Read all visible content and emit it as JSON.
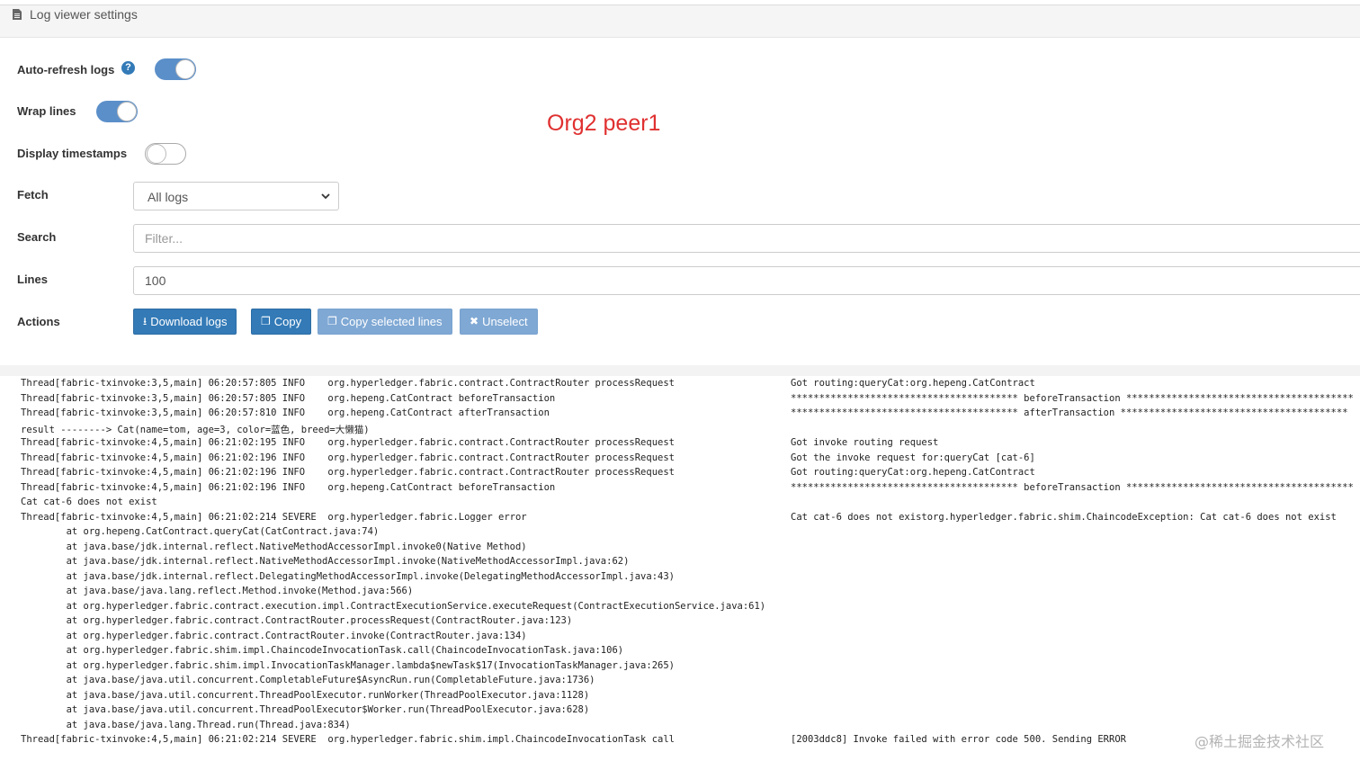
{
  "header": {
    "title": "Log viewer settings",
    "icon": "document-icon"
  },
  "settings": {
    "auto_refresh": {
      "label": "Auto-refresh logs",
      "help_glyph": "?",
      "enabled": true
    },
    "wrap_lines": {
      "label": "Wrap lines",
      "enabled": true
    },
    "display_timestamps": {
      "label": "Display timestamps",
      "enabled": false
    },
    "fetch": {
      "label": "Fetch",
      "selected": "All logs"
    },
    "search": {
      "label": "Search",
      "placeholder": "Filter..."
    },
    "lines": {
      "label": "Lines",
      "value": "100"
    },
    "actions": {
      "label": "Actions",
      "download": {
        "label": "Download logs",
        "icon": "download-icon",
        "glyph": "⭳"
      },
      "copy": {
        "label": "Copy",
        "icon": "copy-icon",
        "glyph": "❐"
      },
      "copy_selected": {
        "label": "Copy selected lines",
        "icon": "copy-icon",
        "glyph": "❐"
      },
      "unselect": {
        "label": "Unselect",
        "icon": "close-icon",
        "glyph": "✖"
      }
    }
  },
  "annotation": "Org2 peer1",
  "log_lines": [
    {
      "left": "Thread[fabric-txinvoke:3,5,main] 06:20:57:805 INFO    org.hyperledger.fabric.contract.ContractRouter processRequest",
      "right": "Got routing:queryCat:org.hepeng.CatContract"
    },
    {
      "left": "Thread[fabric-txinvoke:3,5,main] 06:20:57:805 INFO    org.hepeng.CatContract beforeTransaction",
      "right": "**************************************** beforeTransaction ****************************************"
    },
    {
      "left": "Thread[fabric-txinvoke:3,5,main] 06:20:57:810 INFO    org.hepeng.CatContract afterTransaction",
      "right": "**************************************** afterTransaction ****************************************"
    },
    {
      "left": "result --------> Cat(name=tom, age=3, color=蓝色, breed=大懒猫)",
      "right": ""
    },
    {
      "left": "Thread[fabric-txinvoke:4,5,main] 06:21:02:195 INFO    org.hyperledger.fabric.contract.ContractRouter processRequest",
      "right": "Got invoke routing request"
    },
    {
      "left": "Thread[fabric-txinvoke:4,5,main] 06:21:02:196 INFO    org.hyperledger.fabric.contract.ContractRouter processRequest",
      "right": "Got the invoke request for:queryCat [cat-6]"
    },
    {
      "left": "Thread[fabric-txinvoke:4,5,main] 06:21:02:196 INFO    org.hyperledger.fabric.contract.ContractRouter processRequest",
      "right": "Got routing:queryCat:org.hepeng.CatContract"
    },
    {
      "left": "Thread[fabric-txinvoke:4,5,main] 06:21:02:196 INFO    org.hepeng.CatContract beforeTransaction",
      "right": "**************************************** beforeTransaction ****************************************"
    },
    {
      "left": "Cat cat-6 does not exist",
      "right": ""
    },
    {
      "left": "Thread[fabric-txinvoke:4,5,main] 06:21:02:214 SEVERE  org.hyperledger.fabric.Logger error",
      "right": "Cat cat-6 does not existorg.hyperledger.fabric.shim.ChaincodeException: Cat cat-6 does not exist"
    },
    {
      "left": "        at org.hepeng.CatContract.queryCat(CatContract.java:74)",
      "right": ""
    },
    {
      "left": "        at java.base/jdk.internal.reflect.NativeMethodAccessorImpl.invoke0(Native Method)",
      "right": ""
    },
    {
      "left": "        at java.base/jdk.internal.reflect.NativeMethodAccessorImpl.invoke(NativeMethodAccessorImpl.java:62)",
      "right": ""
    },
    {
      "left": "        at java.base/jdk.internal.reflect.DelegatingMethodAccessorImpl.invoke(DelegatingMethodAccessorImpl.java:43)",
      "right": ""
    },
    {
      "left": "        at java.base/java.lang.reflect.Method.invoke(Method.java:566)",
      "right": ""
    },
    {
      "left": "        at org.hyperledger.fabric.contract.execution.impl.ContractExecutionService.executeRequest(ContractExecutionService.java:61)",
      "right": ""
    },
    {
      "left": "        at org.hyperledger.fabric.contract.ContractRouter.processRequest(ContractRouter.java:123)",
      "right": ""
    },
    {
      "left": "        at org.hyperledger.fabric.contract.ContractRouter.invoke(ContractRouter.java:134)",
      "right": ""
    },
    {
      "left": "        at org.hyperledger.fabric.shim.impl.ChaincodeInvocationTask.call(ChaincodeInvocationTask.java:106)",
      "right": ""
    },
    {
      "left": "        at org.hyperledger.fabric.shim.impl.InvocationTaskManager.lambda$newTask$17(InvocationTaskManager.java:265)",
      "right": ""
    },
    {
      "left": "        at java.base/java.util.concurrent.CompletableFuture$AsyncRun.run(CompletableFuture.java:1736)",
      "right": ""
    },
    {
      "left": "        at java.base/java.util.concurrent.ThreadPoolExecutor.runWorker(ThreadPoolExecutor.java:1128)",
      "right": ""
    },
    {
      "left": "        at java.base/java.util.concurrent.ThreadPoolExecutor$Worker.run(ThreadPoolExecutor.java:628)",
      "right": ""
    },
    {
      "left": "        at java.base/java.lang.Thread.run(Thread.java:834)",
      "right": ""
    },
    {
      "left": "Thread[fabric-txinvoke:4,5,main] 06:21:02:214 SEVERE  org.hyperledger.fabric.shim.impl.ChaincodeInvocationTask call",
      "right": "[2003ddc8] Invoke failed with error code 500. Sending ERROR"
    }
  ],
  "watermark": "@稀土掘金技术社区"
}
